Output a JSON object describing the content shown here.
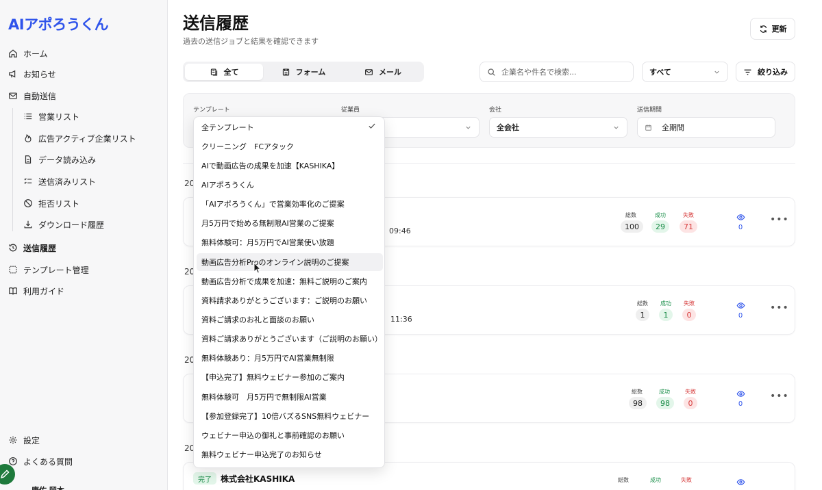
{
  "brand": "AIアポろうくん",
  "sidebar": {
    "items": [
      {
        "label": "ホーム",
        "icon": "home-icon"
      },
      {
        "label": "お知らせ",
        "icon": "megaphone-icon"
      },
      {
        "label": "自動送信",
        "icon": "mail-icon"
      },
      {
        "label": "営業リスト",
        "icon": "list-icon"
      },
      {
        "label": "広告アクティブ企業リスト",
        "icon": "flame-icon"
      },
      {
        "label": "データ読み込み",
        "icon": "file-icon"
      },
      {
        "label": "送信済みリスト",
        "icon": "checklist-icon"
      },
      {
        "label": "拒否リスト",
        "icon": "ban-icon"
      },
      {
        "label": "ダウンロード履歴",
        "icon": "download-icon"
      },
      {
        "label": "送信履歴",
        "icon": "history-icon"
      },
      {
        "label": "テンプレート管理",
        "icon": "template-icon"
      },
      {
        "label": "利用ガイド",
        "icon": "book-icon"
      }
    ],
    "settings": "設定",
    "faq": "よくある質問",
    "user": "康佑 岡本"
  },
  "header": {
    "title": "送信履歴",
    "subtitle": "過去の送信ジョブと結果を確認できます",
    "refresh": "更新"
  },
  "tabs": [
    {
      "label": "全て"
    },
    {
      "label": "フォーム"
    },
    {
      "label": "メール"
    }
  ],
  "search": {
    "placeholder": "企業名や件名で検索..."
  },
  "status_select": "すべて",
  "filter_button": "絞り込み",
  "filters": {
    "template_label": "テンプレート",
    "staff_label": "従業員",
    "company_label": "会社",
    "company_value": "全会社",
    "period_label": "送信期間",
    "period_value": "全期間"
  },
  "stats_labels": {
    "total": "総数",
    "success": "成功",
    "fail": "失敗"
  },
  "groups": [
    {
      "date": "20",
      "time": "09:46",
      "total": "100",
      "success": "29",
      "fail": "71",
      "views": "0"
    },
    {
      "date": "20",
      "time": "11:36",
      "total": "1",
      "success": "1",
      "fail": "0",
      "views": "0"
    },
    {
      "date": "20",
      "time": "",
      "total": "98",
      "success": "98",
      "fail": "0",
      "views": "0"
    },
    {
      "date": "20",
      "badge": "完了",
      "company": "株式会社KASHIKA"
    }
  ],
  "dropdown": {
    "options": [
      "全テンプレート",
      "クリーニング　FCアタック",
      "AIで動画広告の成果を加速【KASHIKA】",
      "AIアポろうくん",
      "「AIアポろうくん」で営業効率化のご提案",
      "月5万円で始める無制限AI営業のご提案",
      "無料体験可：月5万円でAI営業使い放題",
      "動画広告分析Proのオンライン説明のご提案",
      "動画広告分析で成果を加速：無料ご説明のご案内",
      "資料請求ありがとうございます：ご説明のお願い",
      "資料ご請求のお礼と面談のお願い",
      "資料ご請求ありがとうございます（ご説明のお願い）",
      "無料体験あり：月5万円でAI営業無制限",
      "【申込完了】無料ウェビナー参加のご案内",
      "無料体験可　月5万円で無制限AI営業",
      "【参加登録完了】10倍バズるSNS無料ウェビナー",
      "ウェビナー申込の御礼と事前確認のお願い",
      "無料ウェビナー申込完了のお知らせ"
    ],
    "selected_index": 0,
    "hover_index": 7
  },
  "colors": {
    "brand": "#2f54eb",
    "success": "#178a45",
    "fail": "#d63b3b"
  }
}
